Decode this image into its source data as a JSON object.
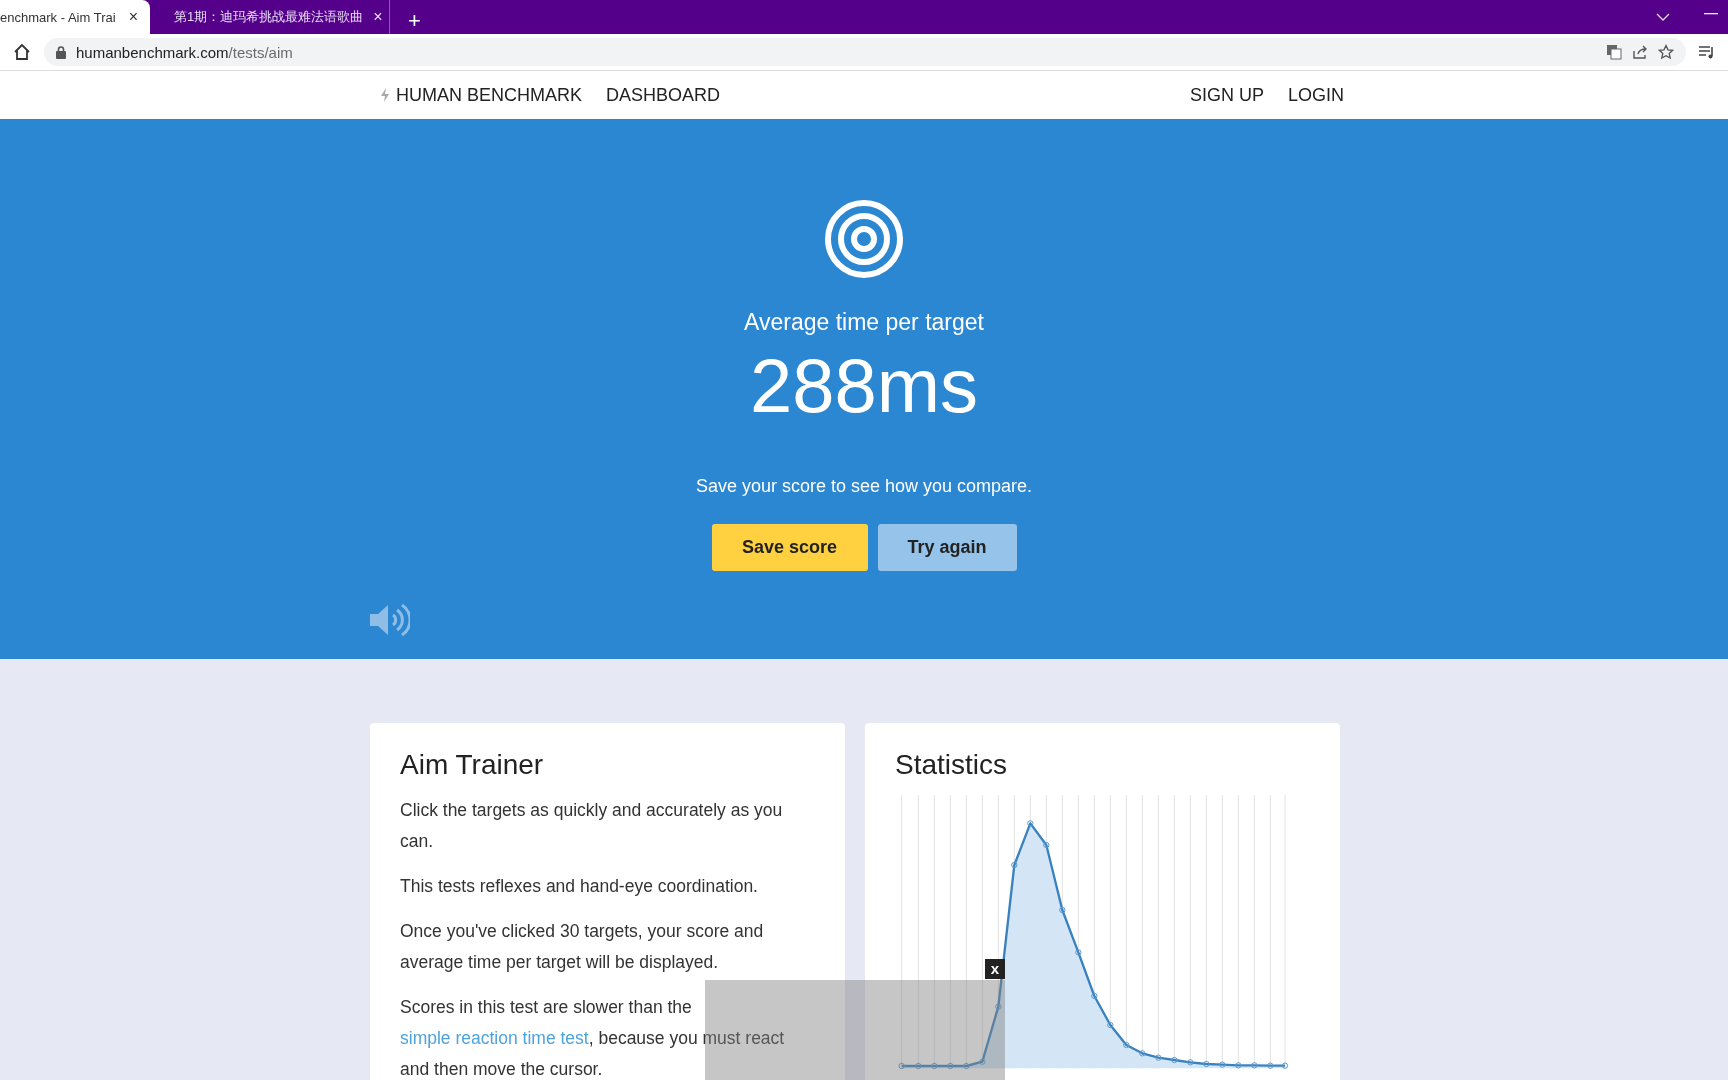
{
  "browser": {
    "tabs": [
      {
        "title": "enchmark - Aim Trai",
        "close": "×",
        "selected": true
      },
      {
        "title": "第1期：迪玛希挑战最难法语歌曲",
        "close": "×",
        "selected": false
      }
    ],
    "new_tab": "+",
    "url": {
      "host": "humanbenchmark.com",
      "path": "/tests/aim"
    }
  },
  "nav": {
    "brand": "HUMAN BENCHMARK",
    "links": [
      "DASHBOARD"
    ],
    "right_links": [
      "SIGN UP",
      "LOGIN"
    ]
  },
  "hero": {
    "label": "Average time per target",
    "score": "288ms",
    "subtitle": "Save your score to see how you compare.",
    "buttons": [
      {
        "label": "Save score",
        "kind": "primary"
      },
      {
        "label": "Try again",
        "kind": "secondary"
      }
    ]
  },
  "about": {
    "title": "Aim Trainer",
    "paragraphs": [
      {
        "text": "Click the targets as quickly and accurately as you can."
      },
      {
        "text": "This tests reflexes and hand-eye coordination."
      },
      {
        "text": "Once you've clicked 30 targets, your score and average time per target will be displayed."
      },
      {
        "text": "Scores in this test are slower than the",
        "link": "simple reaction time test",
        "after": ", because you must react and then move the cursor."
      }
    ]
  },
  "statistics": {
    "title": "Statistics"
  },
  "overlay": {
    "close": "x"
  }
}
